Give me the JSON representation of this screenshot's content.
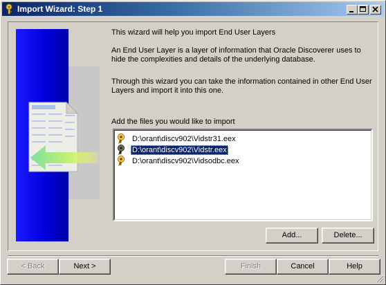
{
  "window": {
    "title": "Import Wizard: Step 1",
    "controls": [
      "minimize-icon",
      "maximize-icon",
      "close-icon"
    ]
  },
  "intro": {
    "p1": "This wizard will help you import End User Layers",
    "p2": "An End User Layer is a layer of information that Oracle Discoverer uses to hide the complexities and details of the underlying database.",
    "p3": "Through this wizard you can take the information contained in other End User Layers and import it into this one."
  },
  "files": {
    "label": "Add the files you would like to import",
    "items": [
      {
        "path": "D:\\orant\\discv902\\Vidstr31.eex",
        "selected": false
      },
      {
        "path": "D:\\orant\\discv902\\Vidstr.eex",
        "selected": true
      },
      {
        "path": "D:\\orant\\discv902\\Vidsodbc.eex",
        "selected": false
      }
    ]
  },
  "buttons": {
    "add": "Add...",
    "delete": "Delete...",
    "back": "< Back",
    "next": "Next >",
    "finish": "Finish",
    "cancel": "Cancel",
    "help": "Help"
  },
  "colors": {
    "selection": "#0a246a",
    "side_panel": "#0000dd",
    "face": "#d4d0c8"
  }
}
